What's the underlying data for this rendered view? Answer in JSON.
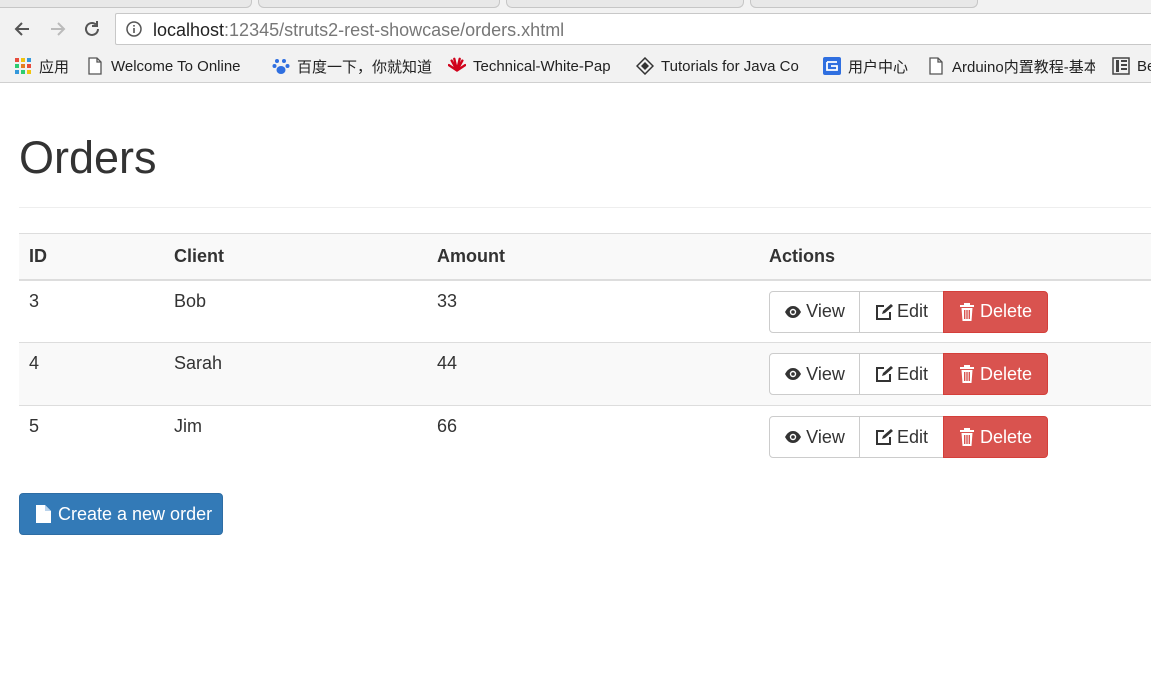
{
  "browser": {
    "url_host": "localhost",
    "url_path": ":12345/struts2-rest-showcase/orders.xhtml",
    "bookmarks": [
      {
        "label": "应用",
        "icon": "apps-grid-icon"
      },
      {
        "label": "Welcome To Online",
        "icon": "page-icon"
      },
      {
        "label": "百度一下，你就知道",
        "icon": "baidu-paw-icon"
      },
      {
        "label": "Technical-White-Pap",
        "icon": "huawei-logo-icon"
      },
      {
        "label": "Tutorials for Java Co",
        "icon": "diamond-logo-icon"
      },
      {
        "label": "用户中心",
        "icon": "user-center-icon"
      },
      {
        "label": "Arduino内置教程-基本",
        "icon": "page-icon"
      },
      {
        "label": "Be",
        "icon": "book-icon"
      }
    ]
  },
  "page": {
    "title": "Orders",
    "table": {
      "headers": [
        "ID",
        "Client",
        "Amount",
        "Actions"
      ],
      "rows": [
        {
          "id": "3",
          "client": "Bob",
          "amount": "33"
        },
        {
          "id": "4",
          "client": "Sarah",
          "amount": "44"
        },
        {
          "id": "5",
          "client": "Jim",
          "amount": "66"
        }
      ],
      "actions": {
        "view": "View",
        "edit": "Edit",
        "delete": "Delete"
      }
    },
    "create_button": "Create a new order"
  },
  "colors": {
    "primary": "#337ab7",
    "danger": "#d9534f",
    "stripe": "#f9f9f9"
  }
}
